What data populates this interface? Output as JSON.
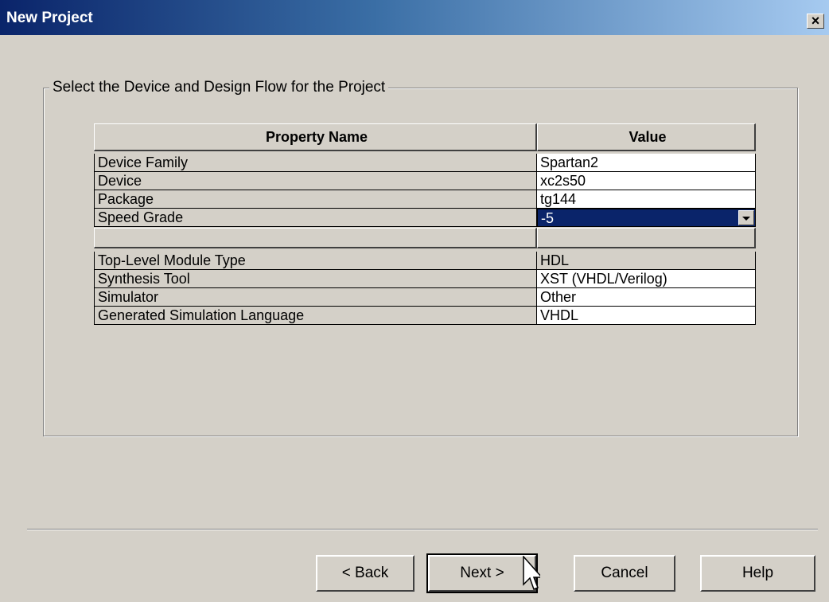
{
  "window": {
    "title": "New Project",
    "close_label": "✕"
  },
  "group": {
    "label": "Select the Device and Design Flow for the Project"
  },
  "table": {
    "headers": {
      "name": "Property Name",
      "value": "Value"
    },
    "rows_top": [
      {
        "name": "Device Family",
        "value": "Spartan2"
      },
      {
        "name": "Device",
        "value": "xc2s50"
      },
      {
        "name": "Package",
        "value": "tg144"
      },
      {
        "name": "Speed Grade",
        "value": "-5"
      }
    ],
    "rows_bottom": [
      {
        "name": "Top-Level Module Type",
        "value": "HDL"
      },
      {
        "name": "Synthesis Tool",
        "value": "XST (VHDL/Verilog)"
      },
      {
        "name": "Simulator",
        "value": "Other"
      },
      {
        "name": "Generated Simulation Language",
        "value": "VHDL"
      }
    ]
  },
  "buttons": {
    "back": "< Back",
    "next": "Next >",
    "cancel": "Cancel",
    "help": "Help"
  }
}
